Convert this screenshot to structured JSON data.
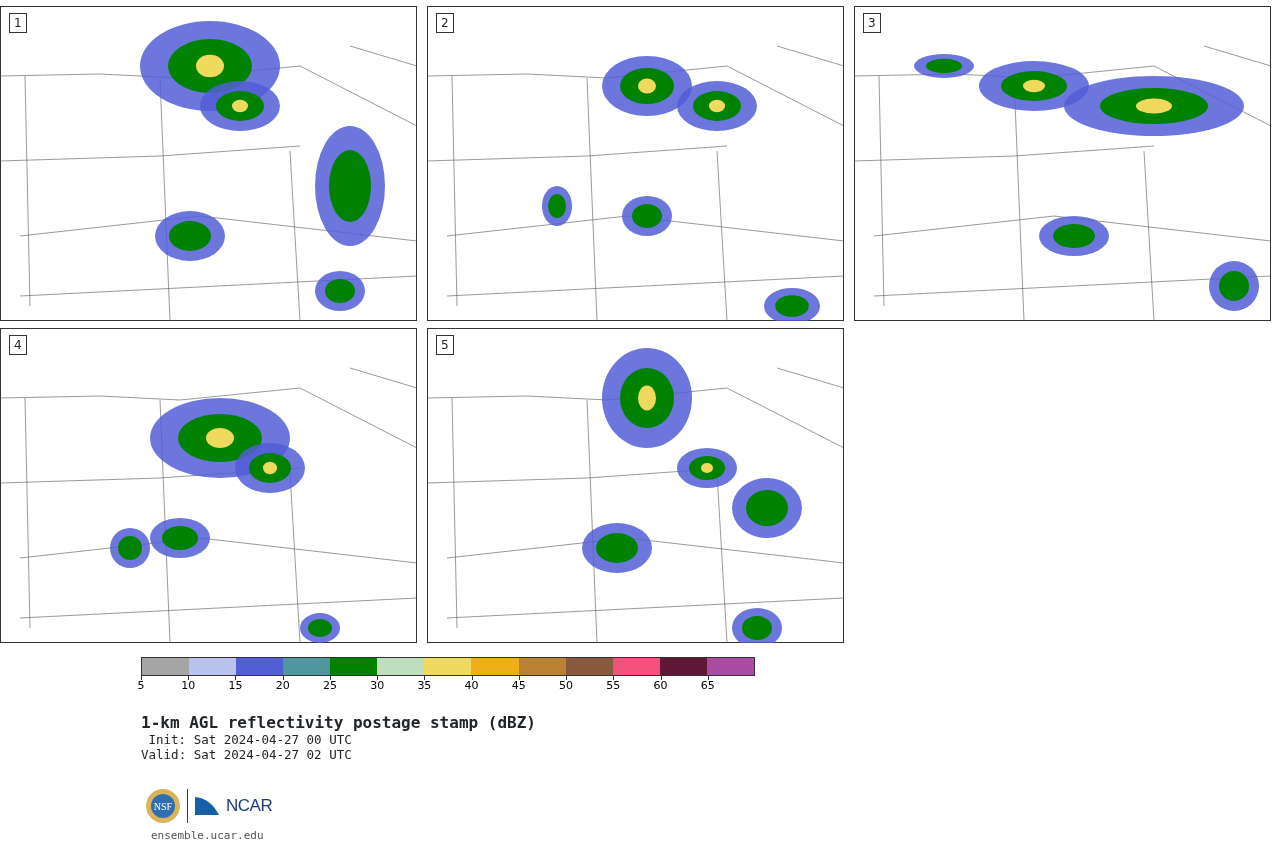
{
  "panels": [
    {
      "label": "1"
    },
    {
      "label": "2"
    },
    {
      "label": "3"
    },
    {
      "label": "4"
    },
    {
      "label": "5"
    }
  ],
  "colorbar": {
    "segments": [
      {
        "color": "#a5a5a5"
      },
      {
        "color": "#b8c2ec"
      },
      {
        "color": "#525ed6"
      },
      {
        "color": "#4f969e"
      },
      {
        "color": "#008200"
      },
      {
        "color": "#bedfbe"
      },
      {
        "color": "#f0da5e"
      },
      {
        "color": "#eeaf18"
      },
      {
        "color": "#bb8233"
      },
      {
        "color": "#8a5a3f"
      },
      {
        "color": "#f4507e"
      },
      {
        "color": "#611837"
      },
      {
        "color": "#ab4aa3"
      }
    ],
    "ticks": [
      "5",
      "10",
      "15",
      "20",
      "25",
      "30",
      "35",
      "40",
      "45",
      "50",
      "55",
      "60",
      "65"
    ]
  },
  "title": "1-km AGL reflectivity postage stamp (dBZ)",
  "init": "Init: Sat 2024-04-27 00 UTC",
  "valid": "Valid: Sat 2024-04-27 02 UTC",
  "logo": {
    "left": "NSF",
    "right": "NCAR"
  },
  "footer": "ensemble.ucar.edu"
}
